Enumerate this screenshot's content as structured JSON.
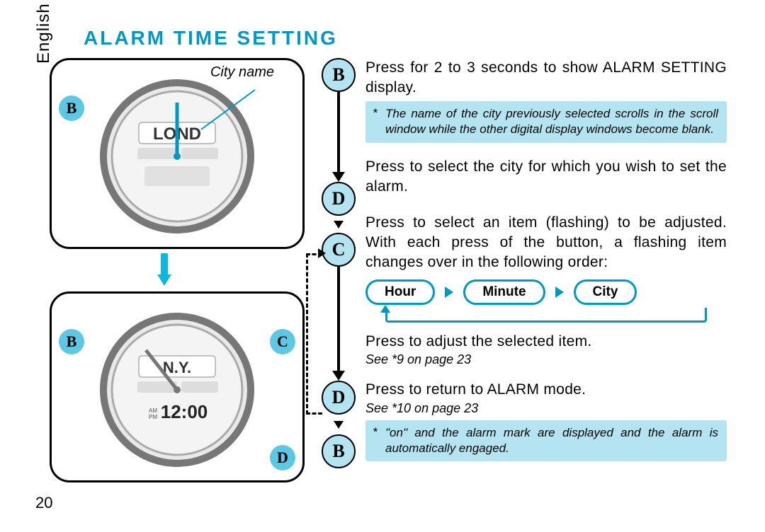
{
  "language": "English",
  "title": "ALARM TIME SETTING",
  "page_number": "20",
  "left": {
    "city_name_label": "City name",
    "panel1": {
      "buttons": {
        "b": "B"
      },
      "display_city": "LOND"
    },
    "panel2": {
      "buttons": {
        "b": "B",
        "c": "C",
        "d": "D"
      },
      "display_city": "N.Y.",
      "display_time": "12:00",
      "ampm": "AM\nPM"
    }
  },
  "flow": {
    "b1": "B",
    "d1": "D",
    "c1": "C",
    "d2": "D",
    "b2": "B"
  },
  "steps": {
    "b1_text": "Press for 2 to 3 seconds to show ALARM SETTING display.",
    "b1_note": "The name of the city previously selected scrolls in the scroll window while the other digital display windows become blank.",
    "d1_text": "Press to select the city for which you wish to set the alarm.",
    "c1_text": "Press to select an item (flashing) to be adjusted. With each press of the button, a flashing item changes over in the following order:",
    "sequence": {
      "hour": "Hour",
      "minute": "Minute",
      "city": "City"
    },
    "d2_text": "Press to adjust the selected item.",
    "d2_ref": "See *9  on page 23",
    "b2_text": "Press to return to ALARM mode.",
    "b2_ref": "See *10 on page 23",
    "b2_note": "\"on\" and the alarm mark are displayed and the alarm is automatically engaged."
  }
}
